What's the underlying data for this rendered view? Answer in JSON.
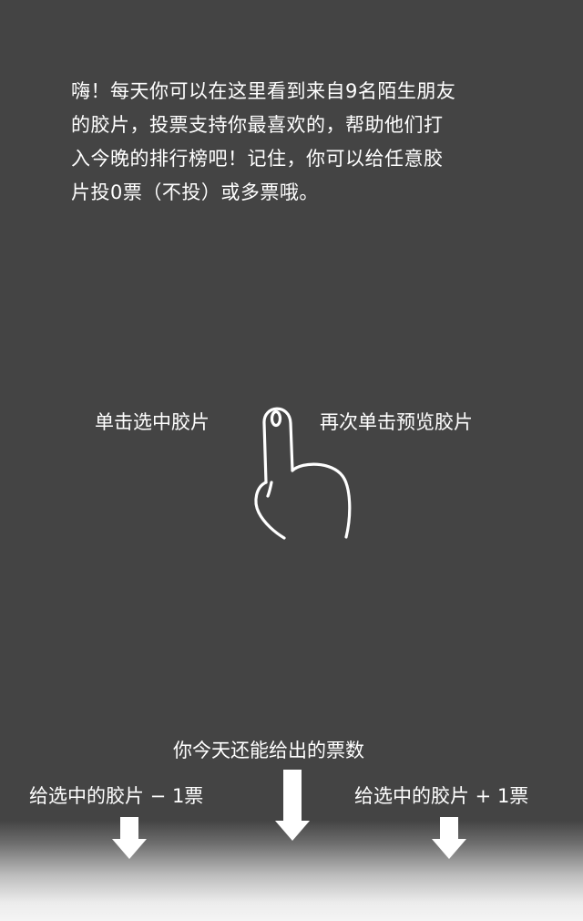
{
  "intro": {
    "line1": "嗨！每天你可以在这里看到来自9名陌生朋友",
    "line2": "的胶片，投票支持你最喜欢的，帮助他们打",
    "line3": "入今晚的排行榜吧！记住，你可以给任意胶",
    "line4": "片投0票（不投）或多票哦。"
  },
  "gestures": {
    "single_tap": "单击选中胶片",
    "double_tap": "再次单击预览胶片",
    "hand_icon": "tap-hand-icon"
  },
  "votes": {
    "remaining": "你今天还能给出的票数",
    "minus": "给选中的胶片 − 1票",
    "plus": "给选中的胶片 + 1票"
  },
  "colors": {
    "overlay": "#444444",
    "text": "#ffffff",
    "footer_gradient_end": "#f4f4f4"
  }
}
